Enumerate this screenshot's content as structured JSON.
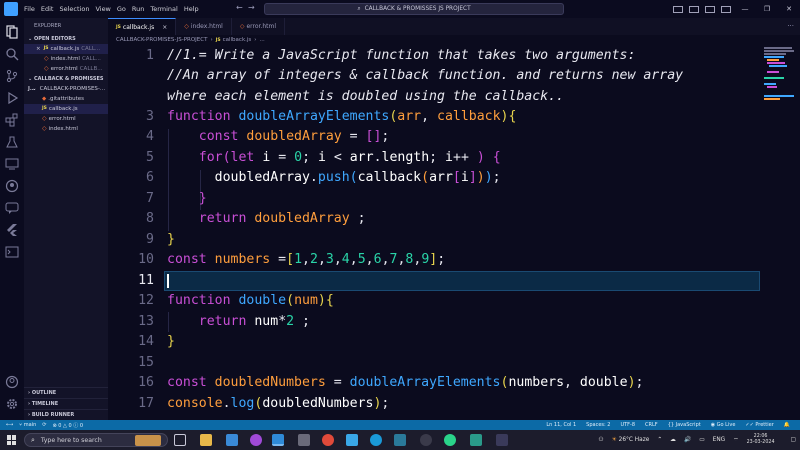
{
  "menu": [
    "File",
    "Edit",
    "Selection",
    "View",
    "Go",
    "Run",
    "Terminal",
    "Help"
  ],
  "command_center": "CALLBACK & PROMISSES JS PROJECT",
  "sidebar": {
    "title": "EXPLORER",
    "open_editors_label": "OPEN EDITORS",
    "open_editors": [
      {
        "name": "callback.js",
        "dim": "CALL...",
        "type": "js",
        "close": "×"
      },
      {
        "name": "index.html",
        "dim": "CALL...",
        "type": "html"
      },
      {
        "name": "error.html",
        "dim": "CALLB...",
        "type": "html"
      }
    ],
    "project_label": "CALLBACK & PROMISSES J...",
    "folder": "CALLBACK-PROMISES-...",
    "files": [
      {
        "name": ".gitattributes",
        "type": "git"
      },
      {
        "name": "callback.js",
        "type": "js"
      },
      {
        "name": "error.html",
        "type": "html"
      },
      {
        "name": "index.html",
        "type": "html"
      }
    ],
    "outline": "OUTLINE",
    "timeline": "TIMELINE",
    "build_runner": "BUILD RUNNER"
  },
  "tabs": [
    {
      "label": "callback.js",
      "type": "js",
      "close": "×"
    },
    {
      "label": "index.html",
      "type": "html"
    },
    {
      "label": "error.html",
      "type": "html"
    }
  ],
  "breadcrumb": [
    "CALLBACK-PROMISES-JS-PROJECT",
    "callback.js",
    "..."
  ],
  "line_numbers": [
    "1",
    "",
    "",
    "3",
    "4",
    "5",
    "6",
    "7",
    "8",
    "9",
    "10",
    "11",
    "12",
    "13",
    "14",
    "15",
    "16",
    "17"
  ],
  "status": {
    "branch": "main",
    "errors": "0",
    "warnings": "0",
    "info": "0",
    "position": "Ln 11, Col 1",
    "spaces": "Spaces: 2",
    "encoding": "UTF-8",
    "eol": "CRLF",
    "language": "{} JavaScript",
    "golive": "Go Live",
    "prettier": "Prettier"
  },
  "taskbar": {
    "search_placeholder": "Type here to search",
    "weather": "26°C  Haze",
    "lang": "ENG",
    "time": "22:06",
    "date": "23-03-2024"
  },
  "colors": {
    "keyword": "#c94fd6",
    "function": "#3fa8ff",
    "param": "#ff9e3d",
    "number": "#2ad4a8",
    "statusbar": "#0c6aa6"
  }
}
